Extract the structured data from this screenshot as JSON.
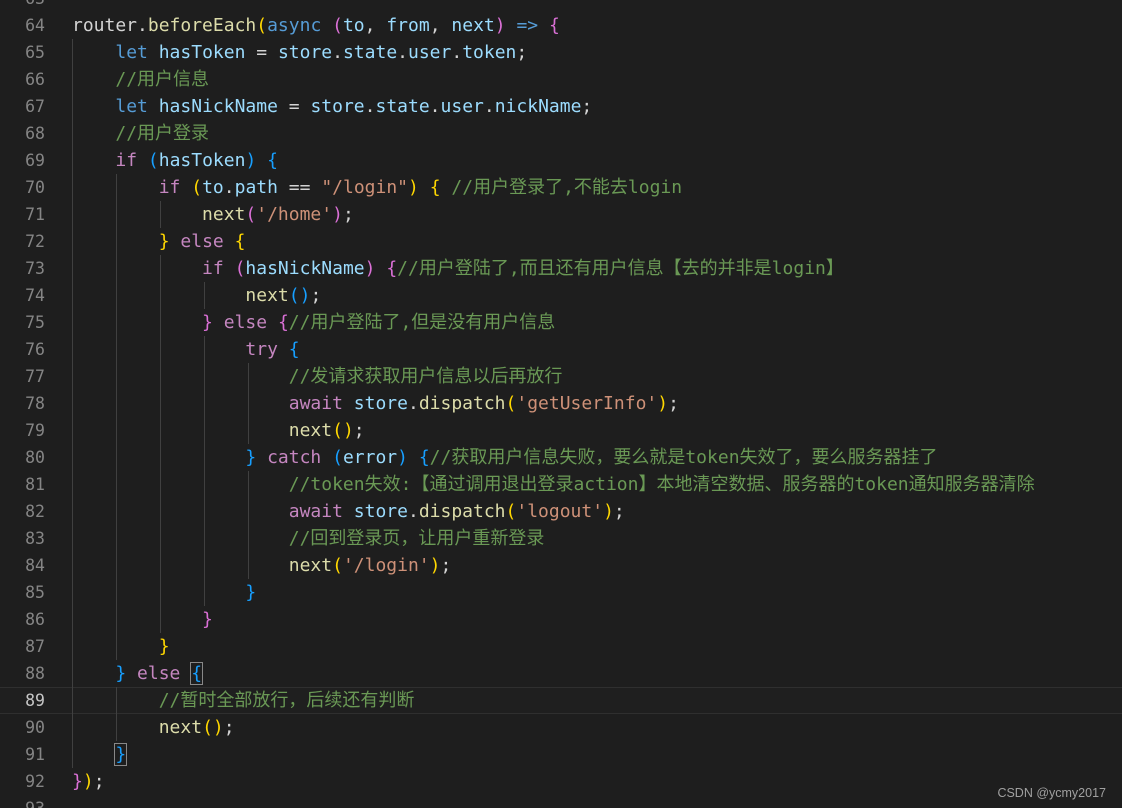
{
  "editor": {
    "colors": {
      "background": "#1e1e1e",
      "gutter_text": "#858585",
      "keyword": "#569cd6",
      "control": "#c586c0",
      "function": "#dcdcaa",
      "variable": "#9cdcfe",
      "string": "#ce9178",
      "comment": "#6a9955",
      "bracket_level1": "#ffd700",
      "bracket_level2": "#da70d6",
      "bracket_level3": "#179fff"
    },
    "current_line": "89",
    "partial_top_line": "63",
    "partial_bottom_line": "93",
    "lines": [
      {
        "n": "64",
        "tokens": [
          [
            "router",
            "t-pun"
          ],
          [
            ".",
            "t-pun"
          ],
          [
            "beforeEach",
            "t-fn"
          ],
          [
            "(",
            "b1"
          ],
          [
            "async",
            "t-kw"
          ],
          [
            " ",
            "t-pun"
          ],
          [
            "(",
            "b2"
          ],
          [
            "to",
            "t-var"
          ],
          [
            ", ",
            "t-pun"
          ],
          [
            "from",
            "t-var"
          ],
          [
            ", ",
            "t-pun"
          ],
          [
            "next",
            "t-var"
          ],
          [
            ")",
            "b2"
          ],
          [
            " ",
            "t-pun"
          ],
          [
            "=>",
            "t-arrow"
          ],
          [
            " ",
            "t-pun"
          ],
          [
            "{",
            "b2"
          ]
        ]
      },
      {
        "n": "65",
        "tokens": [
          [
            "    ",
            "t-pun"
          ],
          [
            "let",
            "t-kw"
          ],
          [
            " ",
            "t-pun"
          ],
          [
            "hasToken",
            "t-var"
          ],
          [
            " = ",
            "t-op"
          ],
          [
            "store",
            "t-var"
          ],
          [
            ".",
            "t-pun"
          ],
          [
            "state",
            "t-prop"
          ],
          [
            ".",
            "t-pun"
          ],
          [
            "user",
            "t-prop"
          ],
          [
            ".",
            "t-pun"
          ],
          [
            "token",
            "t-prop"
          ],
          [
            ";",
            "t-pun"
          ]
        ]
      },
      {
        "n": "66",
        "tokens": [
          [
            "    ",
            "t-pun"
          ],
          [
            "//用户信息",
            "t-cmt"
          ]
        ]
      },
      {
        "n": "67",
        "tokens": [
          [
            "    ",
            "t-pun"
          ],
          [
            "let",
            "t-kw"
          ],
          [
            " ",
            "t-pun"
          ],
          [
            "hasNickName",
            "t-var"
          ],
          [
            " = ",
            "t-op"
          ],
          [
            "store",
            "t-var"
          ],
          [
            ".",
            "t-pun"
          ],
          [
            "state",
            "t-prop"
          ],
          [
            ".",
            "t-pun"
          ],
          [
            "user",
            "t-prop"
          ],
          [
            ".",
            "t-pun"
          ],
          [
            "nickName",
            "t-prop"
          ],
          [
            ";",
            "t-pun"
          ]
        ]
      },
      {
        "n": "68",
        "tokens": [
          [
            "    ",
            "t-pun"
          ],
          [
            "//用户登录",
            "t-cmt"
          ]
        ]
      },
      {
        "n": "69",
        "tokens": [
          [
            "    ",
            "t-pun"
          ],
          [
            "if",
            "t-ctl"
          ],
          [
            " ",
            "t-pun"
          ],
          [
            "(",
            "b3"
          ],
          [
            "hasToken",
            "t-var"
          ],
          [
            ")",
            "b3"
          ],
          [
            " ",
            "t-pun"
          ],
          [
            "{",
            "b3"
          ]
        ]
      },
      {
        "n": "70",
        "tokens": [
          [
            "        ",
            "t-pun"
          ],
          [
            "if",
            "t-ctl"
          ],
          [
            " ",
            "t-pun"
          ],
          [
            "(",
            "b1"
          ],
          [
            "to",
            "t-var"
          ],
          [
            ".",
            "t-pun"
          ],
          [
            "path",
            "t-prop"
          ],
          [
            " == ",
            "t-op"
          ],
          [
            "\"/login\"",
            "t-str"
          ],
          [
            ")",
            "b1"
          ],
          [
            " ",
            "t-pun"
          ],
          [
            "{",
            "b1"
          ],
          [
            " ",
            "t-pun"
          ],
          [
            "//用户登录了,不能去login",
            "t-cmt"
          ]
        ]
      },
      {
        "n": "71",
        "tokens": [
          [
            "            ",
            "t-pun"
          ],
          [
            "next",
            "t-fn"
          ],
          [
            "(",
            "b2"
          ],
          [
            "'/home'",
            "t-str"
          ],
          [
            ")",
            "b2"
          ],
          [
            ";",
            "t-pun"
          ]
        ]
      },
      {
        "n": "72",
        "tokens": [
          [
            "        ",
            "t-pun"
          ],
          [
            "}",
            "b1"
          ],
          [
            " ",
            "t-pun"
          ],
          [
            "else",
            "t-ctl"
          ],
          [
            " ",
            "t-pun"
          ],
          [
            "{",
            "b1"
          ]
        ]
      },
      {
        "n": "73",
        "tokens": [
          [
            "            ",
            "t-pun"
          ],
          [
            "if",
            "t-ctl"
          ],
          [
            " ",
            "t-pun"
          ],
          [
            "(",
            "b2"
          ],
          [
            "hasNickName",
            "t-var"
          ],
          [
            ")",
            "b2"
          ],
          [
            " ",
            "t-pun"
          ],
          [
            "{",
            "b2"
          ],
          [
            "//用户登陆了,而且还有用户信息【去的并非是login】",
            "t-cmt"
          ]
        ]
      },
      {
        "n": "74",
        "tokens": [
          [
            "                ",
            "t-pun"
          ],
          [
            "next",
            "t-fn"
          ],
          [
            "(",
            "b3"
          ],
          [
            ")",
            "b3"
          ],
          [
            ";",
            "t-pun"
          ]
        ]
      },
      {
        "n": "75",
        "tokens": [
          [
            "            ",
            "t-pun"
          ],
          [
            "}",
            "b2"
          ],
          [
            " ",
            "t-pun"
          ],
          [
            "else",
            "t-ctl"
          ],
          [
            " ",
            "t-pun"
          ],
          [
            "{",
            "b2"
          ],
          [
            "//用户登陆了,但是没有用户信息",
            "t-cmt"
          ]
        ]
      },
      {
        "n": "76",
        "tokens": [
          [
            "                ",
            "t-pun"
          ],
          [
            "try",
            "t-ctl"
          ],
          [
            " ",
            "t-pun"
          ],
          [
            "{",
            "b3"
          ]
        ]
      },
      {
        "n": "77",
        "tokens": [
          [
            "                    ",
            "t-pun"
          ],
          [
            "//发请求获取用户信息以后再放行",
            "t-cmt"
          ]
        ]
      },
      {
        "n": "78",
        "tokens": [
          [
            "                    ",
            "t-pun"
          ],
          [
            "await",
            "t-ctl"
          ],
          [
            " ",
            "t-pun"
          ],
          [
            "store",
            "t-var"
          ],
          [
            ".",
            "t-pun"
          ],
          [
            "dispatch",
            "t-fn"
          ],
          [
            "(",
            "b1"
          ],
          [
            "'getUserInfo'",
            "t-str"
          ],
          [
            ")",
            "b1"
          ],
          [
            ";",
            "t-pun"
          ]
        ]
      },
      {
        "n": "79",
        "tokens": [
          [
            "                    ",
            "t-pun"
          ],
          [
            "next",
            "t-fn"
          ],
          [
            "(",
            "b1"
          ],
          [
            ")",
            "b1"
          ],
          [
            ";",
            "t-pun"
          ]
        ]
      },
      {
        "n": "80",
        "tokens": [
          [
            "                ",
            "t-pun"
          ],
          [
            "}",
            "b3"
          ],
          [
            " ",
            "t-pun"
          ],
          [
            "catch",
            "t-ctl"
          ],
          [
            " ",
            "t-pun"
          ],
          [
            "(",
            "b3"
          ],
          [
            "error",
            "t-var"
          ],
          [
            ")",
            "b3"
          ],
          [
            " ",
            "t-pun"
          ],
          [
            "{",
            "b3"
          ],
          [
            "//获取用户信息失败，要么就是token失效了，要么服务器挂了",
            "t-cmt"
          ]
        ]
      },
      {
        "n": "81",
        "tokens": [
          [
            "                    ",
            "t-pun"
          ],
          [
            "//token失效:【通过调用退出登录action】本地清空数据、服务器的token通知服务器清除",
            "t-cmt"
          ]
        ]
      },
      {
        "n": "82",
        "tokens": [
          [
            "                    ",
            "t-pun"
          ],
          [
            "await",
            "t-ctl"
          ],
          [
            " ",
            "t-pun"
          ],
          [
            "store",
            "t-var"
          ],
          [
            ".",
            "t-pun"
          ],
          [
            "dispatch",
            "t-fn"
          ],
          [
            "(",
            "b1"
          ],
          [
            "'logout'",
            "t-str"
          ],
          [
            ")",
            "b1"
          ],
          [
            ";",
            "t-pun"
          ]
        ]
      },
      {
        "n": "83",
        "tokens": [
          [
            "                    ",
            "t-pun"
          ],
          [
            "//回到登录页，让用户重新登录",
            "t-cmt"
          ]
        ]
      },
      {
        "n": "84",
        "tokens": [
          [
            "                    ",
            "t-pun"
          ],
          [
            "next",
            "t-fn"
          ],
          [
            "(",
            "b1"
          ],
          [
            "'/login'",
            "t-str"
          ],
          [
            ")",
            "b1"
          ],
          [
            ";",
            "t-pun"
          ]
        ]
      },
      {
        "n": "85",
        "tokens": [
          [
            "                ",
            "t-pun"
          ],
          [
            "}",
            "b3"
          ]
        ]
      },
      {
        "n": "86",
        "tokens": [
          [
            "            ",
            "t-pun"
          ],
          [
            "}",
            "b2"
          ]
        ]
      },
      {
        "n": "87",
        "tokens": [
          [
            "        ",
            "t-pun"
          ],
          [
            "}",
            "b1"
          ]
        ]
      },
      {
        "n": "88",
        "tokens": [
          [
            "    ",
            "t-pun"
          ],
          [
            "}",
            "b3"
          ],
          [
            " ",
            "t-pun"
          ],
          [
            "else",
            "t-ctl"
          ],
          [
            " ",
            "t-pun"
          ],
          [
            "{",
            "b3 b-match"
          ]
        ]
      },
      {
        "n": "89",
        "tokens": [
          [
            "        ",
            "t-pun"
          ],
          [
            "//暂时全部放行，后续还有判断",
            "t-cmt"
          ]
        ]
      },
      {
        "n": "90",
        "tokens": [
          [
            "        ",
            "t-pun"
          ],
          [
            "next",
            "t-fn"
          ],
          [
            "(",
            "b1"
          ],
          [
            ")",
            "b1"
          ],
          [
            ";",
            "t-pun"
          ]
        ]
      },
      {
        "n": "91",
        "tokens": [
          [
            "    ",
            "t-pun"
          ],
          [
            "}",
            "b3 b-match"
          ]
        ]
      },
      {
        "n": "92",
        "tokens": [
          [
            "}",
            "b2"
          ],
          [
            ")",
            "b1"
          ],
          [
            ";",
            "t-pun"
          ]
        ]
      }
    ]
  },
  "watermark": {
    "text": "CSDN @ycmy2017"
  }
}
